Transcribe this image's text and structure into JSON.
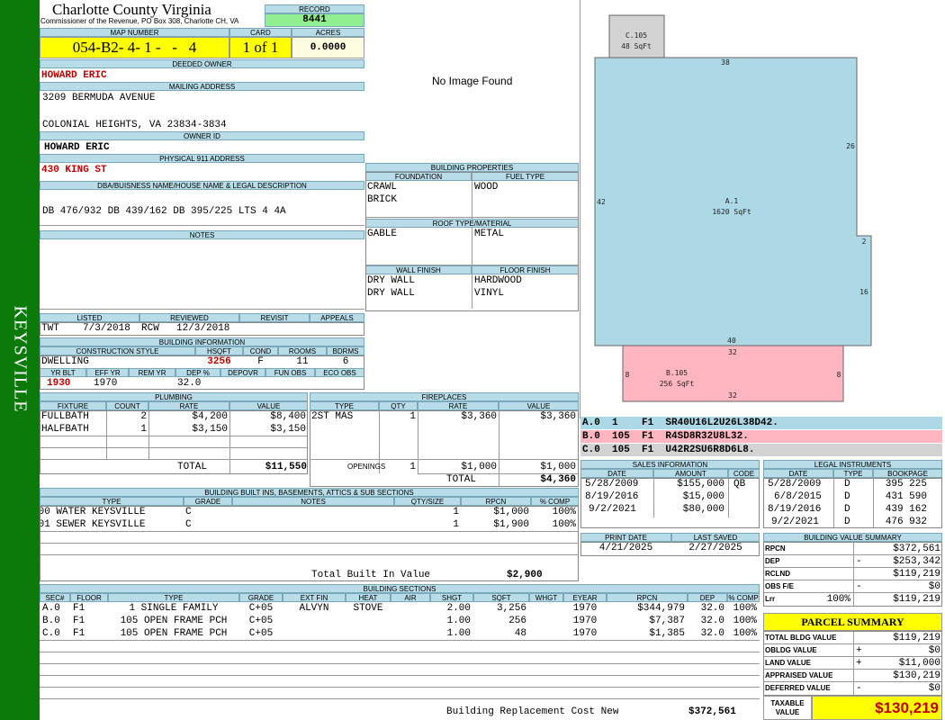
{
  "sidebar": {
    "label": "KEYSVILLE",
    "color": "#0b7a0b"
  },
  "header": {
    "county": "Charlotte County Virginia",
    "commissioner": "Commissioner of the Revenue, PO Box 308, Charlotte CH, VA",
    "record_label": "RECORD",
    "record": "8441"
  },
  "map": {
    "map_label": "MAP NUMBER",
    "map_number": "054-B2- 4- 1 -   -   4",
    "card_label": "CARD",
    "card": "1 of 1",
    "acres_label": "ACRES",
    "acres": "0.0000"
  },
  "owner": {
    "deeded_label": "DEEDED OWNER",
    "deeded": "HOWARD ERIC",
    "mailing_label": "MAILING ADDRESS",
    "mail1": "3209 BERMUDA AVENUE",
    "mail2": "COLONIAL HEIGHTS, VA 23834-3834",
    "ownerid_label": "OWNER ID",
    "ownerid": "HOWARD ERIC",
    "phys_label": "PHYSICAL 911 ADDRESS",
    "phys": "430 KING ST",
    "dba_label": "DBA/BUISNESS NAME/HOUSE NAME & LEGAL DESCRIPTION",
    "dba": "DB 476/932 DB 439/162 DB 395/225 LTS 4 4A",
    "notes_label": "NOTES"
  },
  "image": {
    "no_image": "No Image Found"
  },
  "building_props": {
    "title": "BUILDING PROPERTIES",
    "foundation_label": "FOUNDATION",
    "fuel_label": "FUEL TYPE",
    "foundation1": "CRAWL",
    "foundation2": "BRICK",
    "fuel": "WOOD",
    "roof_label": "ROOF TYPE/MATERIAL",
    "roof_type": "GABLE",
    "roof_mat": "METAL",
    "wall_label": "WALL FINISH",
    "floor_label": "FLOOR FINISH",
    "wall1": "DRY WALL",
    "wall2": "DRY WALL",
    "floor1": "HARDWOOD",
    "floor2": "VINYL"
  },
  "listed": {
    "listed_label": "LISTED",
    "reviewed_label": "REVIEWED",
    "revisit_label": "REVISIT",
    "appeals_label": "APPEALS",
    "listed_by": "TWT",
    "listed_date": "7/3/2018",
    "reviewed_by": "RCW",
    "reviewed_date": "12/3/2018"
  },
  "bldg_info": {
    "title": "BUILDING INFORMATION",
    "cs_label": "CONSTRUCTION STYLE",
    "hsqft_label": "HSQFT",
    "cond_label": "COND",
    "rooms_label": "ROOMS",
    "bdrms_label": "BDRMS",
    "style": "DWELLING",
    "hsqft": "3256",
    "cond": "F",
    "rooms": "11",
    "bdrms": "6",
    "yrblt_label": "YR BLT",
    "effyr_label": "EFF YR",
    "remyr_label": "REM YR",
    "dep_label": "DEP %",
    "depovr_label": "DEPOVR",
    "funobs_label": "FUN OBS",
    "ecoobs_label": "ECO OBS",
    "yrblt": "1930",
    "effyr": "1970",
    "dep": "32.0"
  },
  "plumbing": {
    "title": "PLUMBING",
    "headers": [
      "FIXTURE",
      "COUNT",
      "RATE",
      "VALUE"
    ],
    "rows": [
      {
        "fixture": "FULLBATH",
        "count": "2",
        "rate": "$4,200",
        "value": "$8,400"
      },
      {
        "fixture": "HALFBATH",
        "count": "1",
        "rate": "$3,150",
        "value": "$3,150"
      }
    ],
    "total_label": "TOTAL",
    "total": "$11,550"
  },
  "fireplaces": {
    "title": "FIREPLACES",
    "headers": [
      "TYPE",
      "QTY",
      "RATE",
      "VALUE"
    ],
    "rows": [
      {
        "type": "2ST MAS",
        "qty": "1",
        "rate": "$3,360",
        "value": "$3,360"
      }
    ],
    "openings_label": "OPENINGS",
    "openings_qty": "1",
    "openings_rate": "$1,000",
    "openings_value": "$1,000",
    "total_label": "TOTAL",
    "total": "$4,360"
  },
  "sketch": {
    "c105": "C.105",
    "c105_sqft": "48 SqFt",
    "a1": "A.1",
    "a1_sqft": "1620 SqFt",
    "b105": "B.105",
    "b105_sqft": "256 SqFt",
    "dims": {
      "top": "38",
      "right1": "26",
      "left": "42",
      "step": "2",
      "right2": "16",
      "bottom": "40",
      "b_top": "32",
      "b_left": "8",
      "b_right": "8",
      "b_bottom": "32"
    },
    "colors": {
      "a": "#add8e6",
      "b": "#ffb6c1",
      "c": "#d3d3d3"
    }
  },
  "traverse": [
    "A.0  1    F1  SR40U16L2U26L38D42.",
    "B.0  105  F1  R4SD8R32U8L32.",
    "C.0  105  F1  U42R2SU6R8D6L8."
  ],
  "sales": {
    "title": "SALES INFORMATION",
    "headers": [
      "DATE",
      "AMOUNT",
      "CODE"
    ],
    "rows": [
      {
        "date": "5/28/2009",
        "amount": "$155,000",
        "code": "QB"
      },
      {
        "date": "8/19/2016",
        "amount": "$15,000",
        "code": ""
      },
      {
        "date": "9/2/2021",
        "amount": "$80,000",
        "code": ""
      }
    ]
  },
  "legal": {
    "title": "LEGAL INSTRUMENTS",
    "headers": [
      "DATE",
      "TYPE",
      "BOOKPAGE"
    ],
    "rows": [
      {
        "date": "5/28/2009",
        "type": "D",
        "book": "395 225"
      },
      {
        "date": "6/8/2015",
        "type": "D",
        "book": "431 590"
      },
      {
        "date": "8/19/2016",
        "type": "D",
        "book": "439 162"
      },
      {
        "date": "9/2/2021",
        "type": "D",
        "book": "476 932"
      }
    ]
  },
  "print": {
    "print_label": "PRINT DATE",
    "saved_label": "LAST SAVED",
    "print_date": "4/21/2025",
    "saved_date": "2/27/2025"
  },
  "bv_summary": {
    "title": "BUILDING VALUE SUMMARY",
    "rows": [
      {
        "label": "RPCN",
        "sign": "",
        "value": "$372,561"
      },
      {
        "label": "DEP",
        "sign": "-",
        "value": "$253,342"
      },
      {
        "label": "RCLND",
        "sign": "",
        "value": "$119,219"
      },
      {
        "label": "OBS F/E",
        "sign": "-",
        "value": "$0"
      },
      {
        "label": "Lrr",
        "sign": "100%",
        "value": "$119,219"
      }
    ]
  },
  "parcel": {
    "title": "PARCEL SUMMARY",
    "rows": [
      {
        "label": "TOTAL BLDG VALUE",
        "sign": "",
        "value": "$119,219"
      },
      {
        "label": "OBLDG VALUE",
        "sign": "+",
        "value": "$0"
      },
      {
        "label": "LAND VALUE",
        "sign": "+",
        "value": "$11,000"
      },
      {
        "label": "APPRAISED VALUE",
        "sign": "",
        "value": "$130,219"
      },
      {
        "label": "DEFERRED VALUE",
        "sign": "-",
        "value": "$0"
      }
    ],
    "taxable_label": "TAXABLE VALUE",
    "taxable": "$130,219"
  },
  "builtins": {
    "title": "BUILDING BUILT INS, BASEMENTS, ATTICS & SUB SECTIONS",
    "headers": [
      "TYPE",
      "GRADE",
      "NOTES",
      "QTY/SIZE",
      "RPCN",
      "% COMP"
    ],
    "rows": [
      {
        "type": "100 WATER KEYSVILLE",
        "grade": "C",
        "notes": "",
        "qty": "1",
        "rpcn": "$1,000",
        "comp": "100%"
      },
      {
        "type": "101 SEWER KEYSVILLE",
        "grade": "C",
        "notes": "",
        "qty": "1",
        "rpcn": "$1,900",
        "comp": "100%"
      }
    ],
    "total_label": "Total Built In Value",
    "total": "$2,900"
  },
  "sections": {
    "title": "BUILDING SECTIONS",
    "headers": [
      "SEC#",
      "FLOOR",
      "TYPE",
      "GRADE",
      "EXT FIN",
      "HEAT",
      "AIR",
      "SHGT",
      "SQFT",
      "WHGT",
      "EYEAR",
      "RPCN",
      "DEP",
      "% COMP"
    ],
    "rows": [
      {
        "sec": "A.0",
        "floor": "F1",
        "type": "1 SINGLE FAMILY",
        "grade": "C+05",
        "ext": "ALVYN",
        "heat": "STOVE",
        "air": "",
        "shgt": "2.00",
        "sqft": "3,256",
        "whgt": "",
        "eyear": "1970",
        "rpcn": "$344,979",
        "dep": "32.0",
        "comp": "100%"
      },
      {
        "sec": "B.0",
        "floor": "F1",
        "type": "105 OPEN FRAME PCH",
        "grade": "C+05",
        "ext": "",
        "heat": "",
        "air": "",
        "shgt": "1.00",
        "sqft": "256",
        "whgt": "",
        "eyear": "1970",
        "rpcn": "$7,387",
        "dep": "32.0",
        "comp": "100%"
      },
      {
        "sec": "C.0",
        "floor": "F1",
        "type": "105 OPEN FRAME PCH",
        "grade": "C+05",
        "ext": "",
        "heat": "",
        "air": "",
        "shgt": "1.00",
        "sqft": "48",
        "whgt": "",
        "eyear": "1970",
        "rpcn": "$1,385",
        "dep": "32.0",
        "comp": "100%"
      }
    ],
    "brcn_label": "Building Replacement Cost New",
    "brcn": "$372,561"
  }
}
